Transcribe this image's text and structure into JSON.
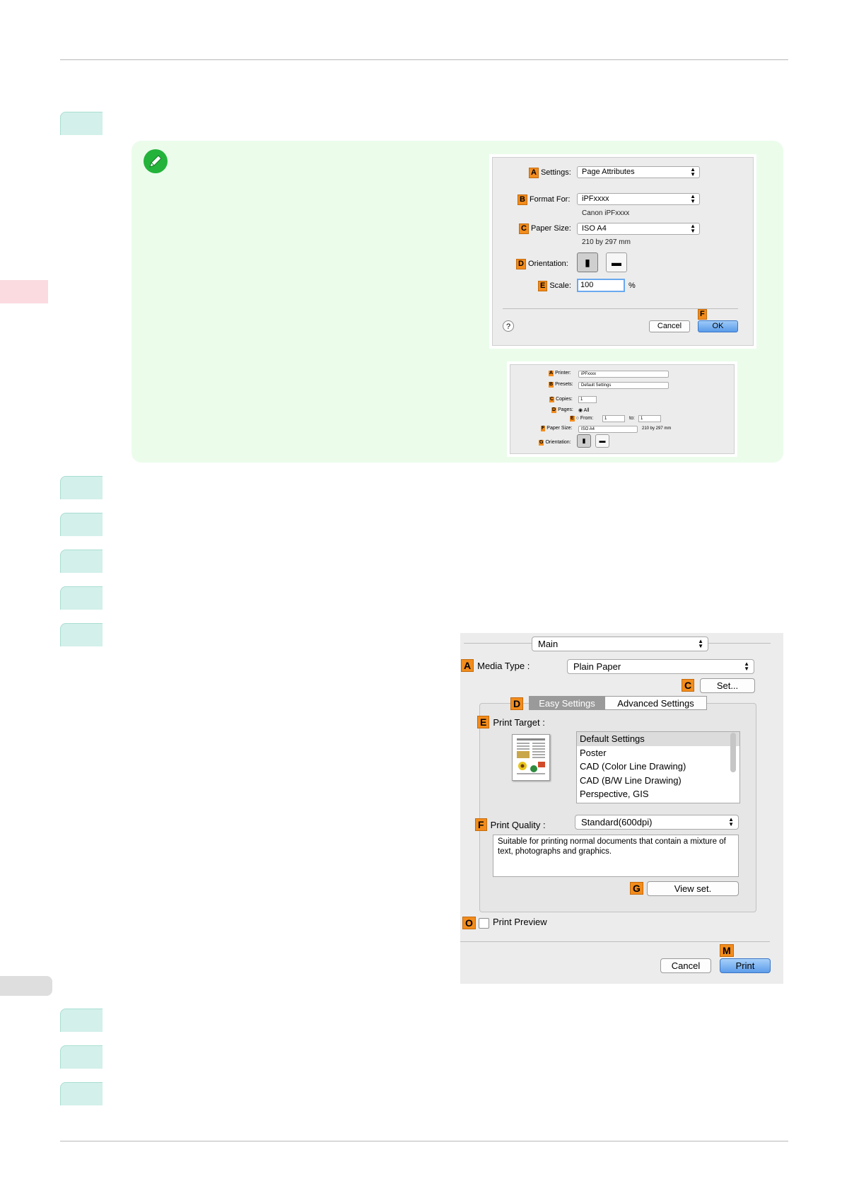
{
  "page_setup_dialog": {
    "settings": {
      "badge": "A",
      "label": "Settings:",
      "value": "Page Attributes"
    },
    "format_for": {
      "badge": "B",
      "label": "Format For:",
      "value": "iPFxxxx",
      "sub": "Canon iPFxxxx"
    },
    "paper_size": {
      "badge": "C",
      "label": "Paper Size:",
      "value": "ISO A4",
      "sub": "210 by 297 mm"
    },
    "orientation": {
      "badge": "D",
      "label": "Orientation:"
    },
    "scale": {
      "badge": "E",
      "label": "Scale:",
      "value": "100",
      "unit": "%"
    },
    "help": "?",
    "cancel": "Cancel",
    "ok": {
      "badge": "F",
      "label": "OK"
    }
  },
  "print_dialog_small": {
    "printer": {
      "badge": "A",
      "label": "Printer:",
      "value": "iPFxxxx"
    },
    "presets": {
      "badge": "B",
      "label": "Presets:",
      "value": "Default Settings"
    },
    "copies": {
      "badge": "C",
      "label": "Copies:",
      "value": "1"
    },
    "pages": {
      "badge": "D",
      "label": "Pages:",
      "all": "All"
    },
    "from": {
      "badge": "E",
      "label": "From:",
      "from_value": "1",
      "to_label": "to:",
      "to_value": "1"
    },
    "paper_size": {
      "badge": "F",
      "label": "Paper Size:",
      "value": "ISO A4",
      "sub": "210 by 297 mm"
    },
    "orientation": {
      "badge": "G",
      "label": "Orientation:"
    }
  },
  "print_dialog": {
    "panel": "Main",
    "media_type": {
      "badge": "A",
      "label": "Media Type :",
      "value": "Plain Paper"
    },
    "set_button": {
      "badge": "C",
      "label": "Set..."
    },
    "tabs": {
      "badge": "D",
      "easy": "Easy Settings",
      "advanced": "Advanced Settings"
    },
    "print_target": {
      "badge": "E",
      "label": "Print Target :",
      "items": [
        "Default Settings",
        "Poster",
        "CAD (Color Line Drawing)",
        "CAD (B/W Line Drawing)",
        "Perspective, GIS"
      ]
    },
    "print_quality": {
      "badge": "F",
      "label": "Print Quality :",
      "value": "Standard(600dpi)"
    },
    "description": "Suitable for printing normal documents that contain a mixture of text, photographs and graphics.",
    "view_set": {
      "badge": "G",
      "label": "View set."
    },
    "print_preview": {
      "badge": "O",
      "label": "Print Preview"
    },
    "cancel": "Cancel",
    "print": {
      "badge": "M",
      "label": "Print"
    }
  },
  "colors": {
    "accent_badge": "#f28c1c",
    "note_bg": "#ebfceb",
    "step_tab": "#d3f0ea",
    "default_button": "#5a9bea"
  }
}
